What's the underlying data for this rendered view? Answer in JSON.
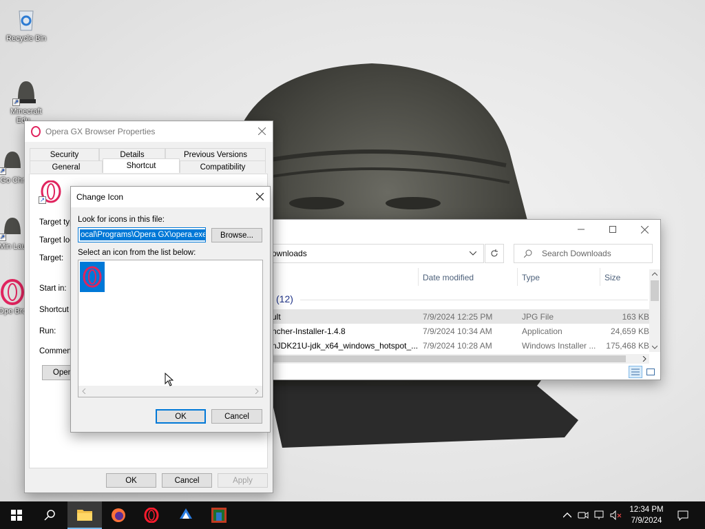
{
  "desktop": {
    "icons": [
      {
        "label": "Recycle Bin"
      },
      {
        "label": "Minecraft Edu..."
      },
      {
        "label": "Go Chr"
      },
      {
        "label": "Min Lau"
      },
      {
        "label": "Ope Bro"
      }
    ]
  },
  "explorer": {
    "address": "ownloads",
    "search_placeholder": "Search Downloads",
    "columns": {
      "date": "Date modified",
      "type": "Type",
      "size": "Size"
    },
    "group_label": "(12)",
    "rows": [
      {
        "name": "ult",
        "date": "7/9/2024 12:25 PM",
        "type": "JPG File",
        "size": "163 KB"
      },
      {
        "name": "ncher-Installer-1.4.8",
        "date": "7/9/2024 10:34 AM",
        "type": "Application",
        "size": "24,659 KB"
      },
      {
        "name": "nJDK21U-jdk_x64_windows_hotspot_...",
        "date": "7/9/2024 10:28 AM",
        "type": "Windows Installer ...",
        "size": "175,468 KB"
      }
    ]
  },
  "props": {
    "title": "Opera GX Browser Properties",
    "tabs_top": [
      "Security",
      "Details",
      "Previous Versions"
    ],
    "tabs_bottom": [
      "General",
      "Shortcut",
      "Compatibility"
    ],
    "fields": {
      "target_type": "Target typ",
      "target_location": "Target loc",
      "target": "Target:",
      "start_in": "Start in:",
      "shortcut_key": "Shortcut k",
      "run": "Run:",
      "comment": "Comment:"
    },
    "open_button": "Open",
    "ok": "OK",
    "cancel": "Cancel",
    "apply": "Apply"
  },
  "change_icon": {
    "title": "Change Icon",
    "look_label": "Look for icons in this file:",
    "path_value": "ocal\\Programs\\Opera GX\\opera.exe",
    "browse": "Browse...",
    "select_label": "Select an icon from the list below:",
    "ok": "OK",
    "cancel": "Cancel"
  },
  "taskbar": {
    "time": "12:34 PM",
    "date": "7/9/2024"
  },
  "colors": {
    "accent": "#0078d7",
    "opera_red": "#e0245e",
    "taskbar": "#101010"
  }
}
